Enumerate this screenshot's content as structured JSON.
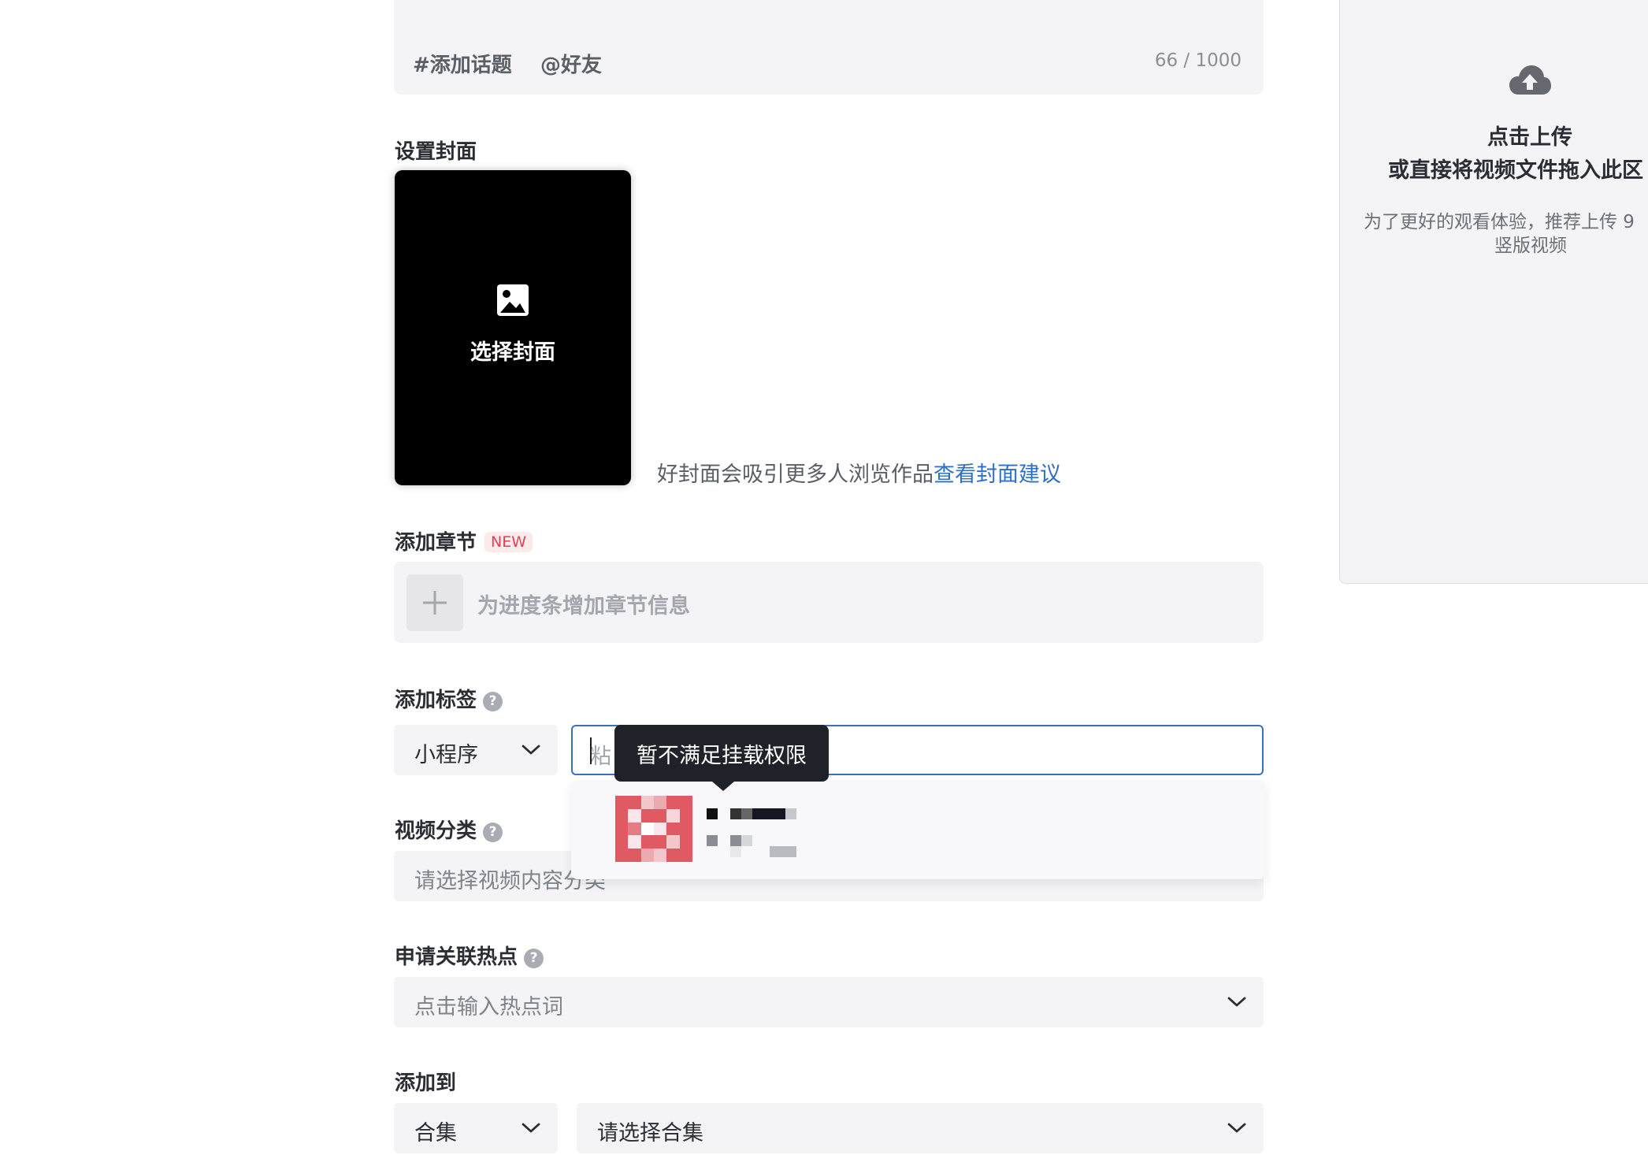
{
  "description": {
    "topic_label": "#添加话题",
    "friend_label": "@好友",
    "char_count": "66 / 1000"
  },
  "cover": {
    "section_label": "设置封面",
    "select_label": "选择封面",
    "hint_text": "好封面会吸引更多人浏览作品",
    "hint_link": "查看封面建议",
    "icon": "image-icon"
  },
  "chapter": {
    "section_label": "添加章节",
    "badge": "NEW",
    "placeholder": "为进度条增加章节信息",
    "icon": "plus-icon"
  },
  "tags": {
    "section_label": "添加标签",
    "type_select": "小程序",
    "input_placeholder": "粘",
    "tooltip": "暂不满足挂载权限"
  },
  "category": {
    "section_label": "视频分类",
    "placeholder": "请选择视频内容分类"
  },
  "hotspot": {
    "section_label": "申请关联热点",
    "placeholder": "点击输入热点词"
  },
  "add_to": {
    "section_label": "添加到",
    "type_select": "合集",
    "collection_placeholder": "请选择合集"
  },
  "upload_panel": {
    "title": "点击上传",
    "subtitle": "或直接将视频文件拖入此区",
    "hint_line1": "为了更好的观看体验，推荐上传 9",
    "hint_line2": "竖版视频",
    "icon": "cloud-upload-icon"
  },
  "colors": {
    "accent_blue": "#2f6fc8",
    "input_border": "#3a6fc4",
    "badge_red": "#e0405a",
    "field_bg": "#f4f4f6"
  }
}
